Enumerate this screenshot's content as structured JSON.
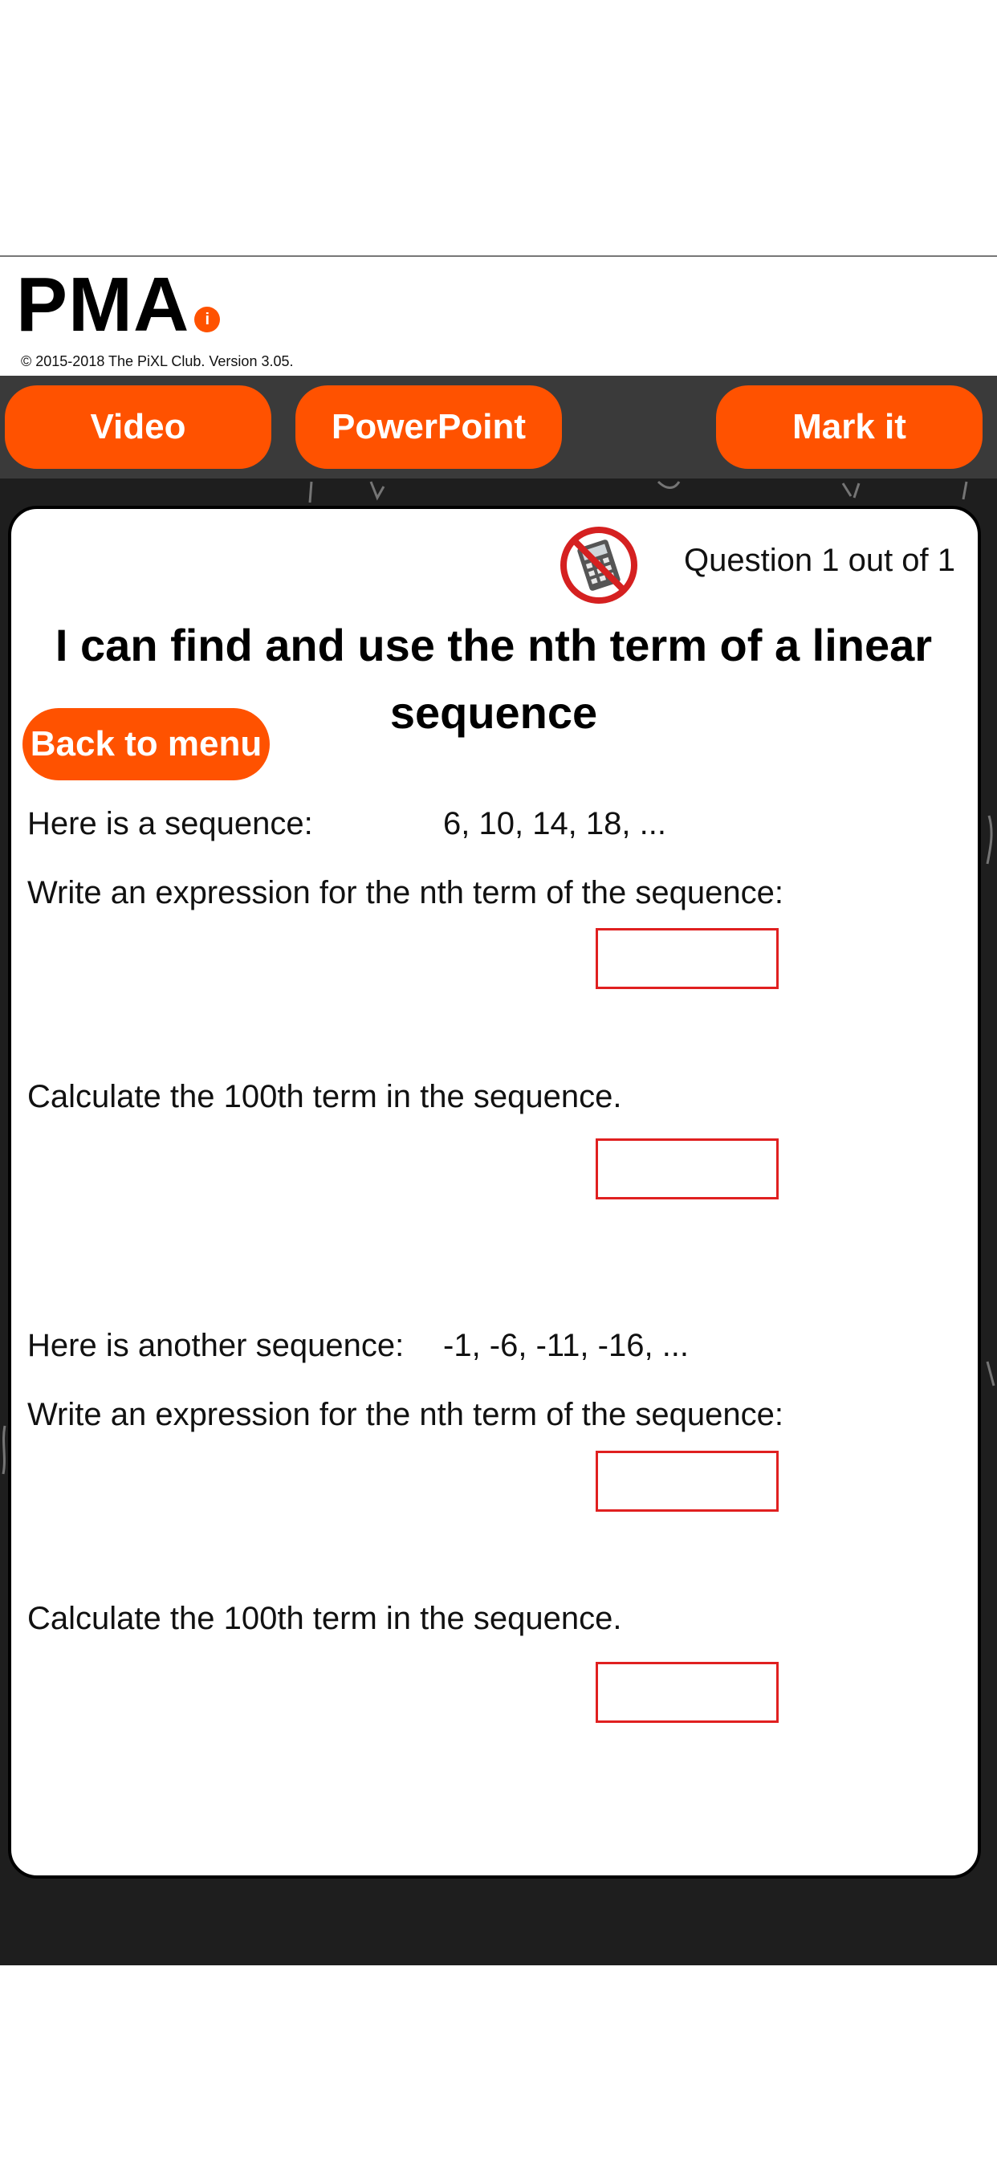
{
  "brand": {
    "name": "PMA",
    "info_icon": "i",
    "copyright": "© 2015-2018 The PiXL Club. Version 3.05."
  },
  "toolbar": {
    "video": "Video",
    "powerpoint": "PowerPoint",
    "mark": "Mark it"
  },
  "header": {
    "question_count": "Question 1 out of 1",
    "no_calculator_icon": "no-calculator-icon"
  },
  "title": "I can find and use the nth term of a linear sequence",
  "back_label": "Back to menu",
  "q1": {
    "intro": "Here is a sequence:",
    "sequence": "6, 10, 14, 18, ...",
    "part_a": "Write an expression for the nth term of the sequence:",
    "part_b": "Calculate the 100th term in the sequence."
  },
  "q2": {
    "intro": "Here is another sequence:",
    "sequence": "-1, -6, -11, -16, ...",
    "part_a": "Write an expression for the nth term of the sequence:",
    "part_b": "Calculate the 100th term in the sequence."
  },
  "answers": {
    "a1": "",
    "b1": "",
    "a2": "",
    "b2": ""
  },
  "colors": {
    "accent": "#ff5200",
    "answer_border": "#e02020",
    "board": "#1e1e1e"
  }
}
